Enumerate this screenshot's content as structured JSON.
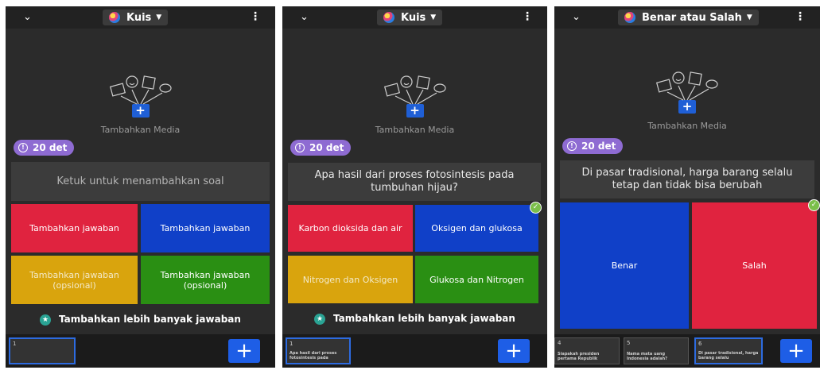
{
  "panels": [
    {
      "quiz_type": "Kuis",
      "add_media_label": "Tambahkan Media",
      "timer": "20 det",
      "question": "Ketuk untuk menambahkan soal",
      "answers": [
        "Tambahkan jawaban",
        "Tambahkan jawaban",
        "Tambahkan jawaban (opsional)",
        "Tambahkan jawaban (opsional)"
      ],
      "more_answers": "Tambahkan lebih banyak jawaban",
      "slides": [
        {
          "num": "1",
          "text": ""
        }
      ]
    },
    {
      "quiz_type": "Kuis",
      "add_media_label": "Tambahkan Media",
      "timer": "20 det",
      "question": "Apa hasil dari proses fotosintesis pada tumbuhan hijau?",
      "answers": [
        "Karbon dioksida dan air",
        "Oksigen dan glukosa",
        "Nitrogen dan Oksigen",
        "Glukosa dan Nitrogen"
      ],
      "correct_answer_index": 1,
      "more_answers": "Tambahkan lebih banyak jawaban",
      "slides": [
        {
          "num": "1",
          "text": "Apa hasil dari proses fotosintesis pada"
        }
      ]
    },
    {
      "quiz_type": "Benar atau Salah",
      "add_media_label": "Tambahkan Media",
      "timer": "20 det",
      "question": "Di pasar tradisional, harga barang selalu tetap dan tidak bisa berubah",
      "answers": [
        "Benar",
        "Salah"
      ],
      "correct_answer_index": 1,
      "slides": [
        {
          "num": "4",
          "text": "Siapakah presiden pertama Republik"
        },
        {
          "num": "5",
          "text": "Nama mata uang Indonesia adalah?"
        },
        {
          "num": "6",
          "text": "Di pasar tradisional, harga barang selalu"
        }
      ]
    }
  ],
  "icons": {
    "add_slide": "plus-icon",
    "menu": "more-vertical-icon",
    "collapse": "chevron-down-icon",
    "check": "check-icon",
    "star": "star-icon",
    "timer": "clock-icon"
  },
  "colors": {
    "red": "#e0233f",
    "blue": "#1040c8",
    "yellow": "#d9a40d",
    "green": "#2a8f13",
    "timer": "#8e6bd2",
    "accent": "#1e5ee6"
  }
}
